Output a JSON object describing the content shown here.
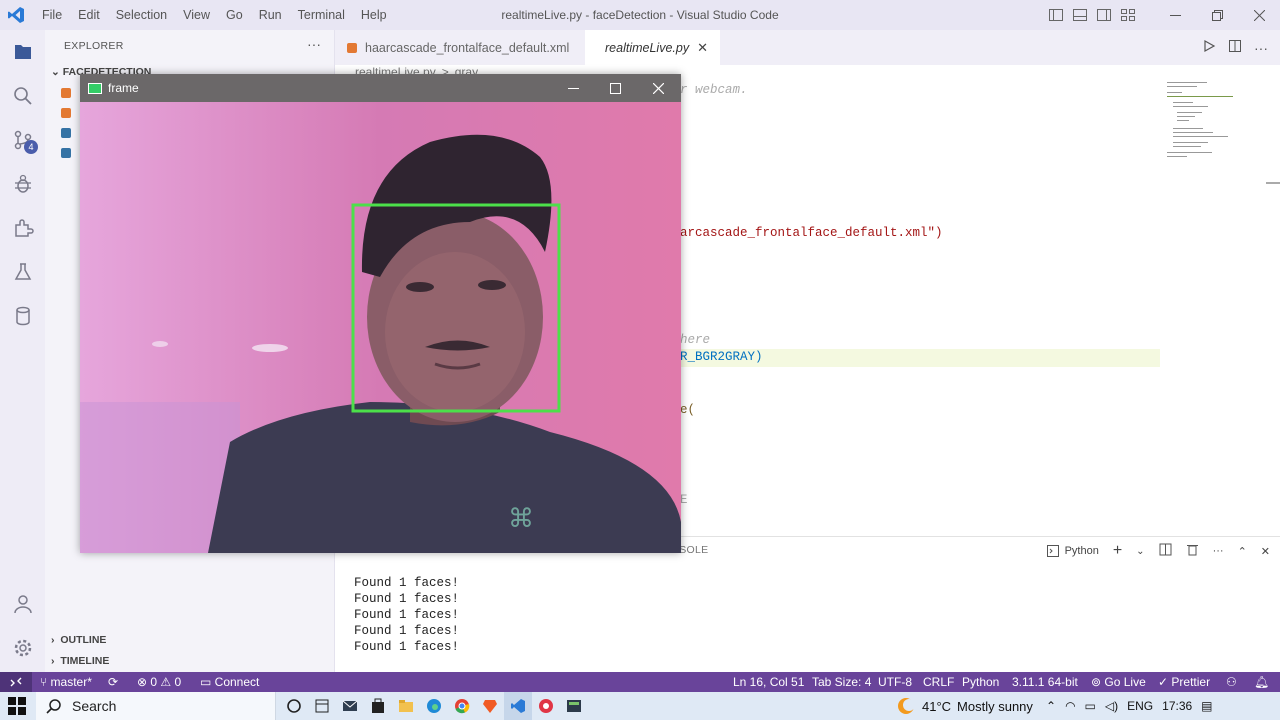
{
  "titlebar": {
    "menu": [
      "File",
      "Edit",
      "Selection",
      "View",
      "Go",
      "Run",
      "Terminal",
      "Help"
    ],
    "window_title": "realtimeLive.py - faceDetection - Visual Studio Code"
  },
  "activitybar": {
    "scm_badge": "4"
  },
  "sidebar": {
    "header": "EXPLORER",
    "more": "···",
    "folder": "FACEDETECTION",
    "outline": "OUTLINE",
    "timeline": "TIMELINE"
  },
  "tabs": {
    "items": [
      {
        "label": "haarcascade_frontalface_default.xml"
      },
      {
        "label": "realtimeLive.py",
        "close": "✕"
      }
    ]
  },
  "breadcrumb": {
    "file": "realtimeLive.py",
    "sep": ">",
    "symbol": "gray"
  },
  "editor": {
    "visible_fragments": [
      "r webcam.",
      "arcascade_frontalface_default.xml\")",
      "here",
      "R_BGR2GRAY)",
      "e(",
      "E"
    ]
  },
  "panel": {
    "visible_tab": "CONSOLE",
    "shell": "Python",
    "output": [
      "Found 1 faces!",
      "Found 1 faces!",
      "Found 1 faces!",
      "Found 1 faces!",
      "Found 1 faces!"
    ]
  },
  "frame_window": {
    "title": "frame"
  },
  "statusbar": {
    "branch": "master*",
    "errors": "0",
    "warnings": "0",
    "connect": "Connect",
    "position": "Ln 16, Col 51",
    "tab_size": "Tab Size: 4",
    "encoding": "UTF-8",
    "eol": "CRLF",
    "language": "Python",
    "interpreter": "3.11.1 64-bit",
    "go_live": "Go Live",
    "prettier": "Prettier"
  },
  "taskbar": {
    "search": "Search",
    "weather_temp": "41°C",
    "weather_desc": "Mostly sunny",
    "language": "ENG",
    "time": "17:36"
  },
  "colors": {
    "statusbar": "#69449a",
    "face_box": "#4ce04a",
    "accent": "#2a7ad6"
  }
}
